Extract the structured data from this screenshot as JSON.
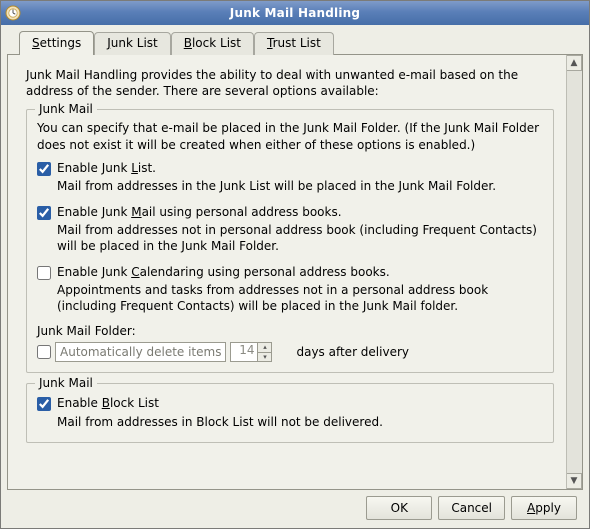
{
  "window": {
    "title": "Junk Mail Handling"
  },
  "tabs": [
    {
      "label": "Settings",
      "mnemonic": "S",
      "active": true
    },
    {
      "label": "Junk List",
      "mnemonic": "J",
      "active": false
    },
    {
      "label": "Block List",
      "mnemonic": "B",
      "active": false
    },
    {
      "label": "Trust List",
      "mnemonic": "T",
      "active": false
    }
  ],
  "intro": "Junk Mail Handling provides the ability to deal with unwanted e-mail based on the address of the sender. There are several options available:",
  "group_junk": {
    "legend": "Junk Mail",
    "desc": "You can specify that e-mail be placed in the Junk Mail Folder. (If the Junk Mail Folder does not exist it will be created when either of these options is enabled.)",
    "opt1": {
      "checked": true,
      "label_pre": "Enable Junk ",
      "mnemonic": "L",
      "label_post": "ist.",
      "desc": "Mail from addresses in the Junk List will be placed in the Junk Mail Folder."
    },
    "opt2": {
      "checked": true,
      "label_pre": "Enable Junk ",
      "mnemonic": "M",
      "label_post": "ail using personal address books.",
      "desc": "Mail from addresses not in personal address book (including Frequent Contacts) will be placed in the Junk Mail Folder."
    },
    "opt3": {
      "checked": false,
      "label_pre": "Enable Junk ",
      "mnemonic": "C",
      "label_post": "alendaring using personal address books.",
      "desc": "Appointments and tasks from addresses not in a personal address book (including Frequent Contacts) will be placed in the Junk Mail folder."
    },
    "folder_label": "Junk Mail Folder:",
    "autodel": {
      "checked": false,
      "label": "Automatically delete items",
      "value": "14",
      "suffix": "days after delivery"
    }
  },
  "group_block": {
    "legend": "Junk Mail",
    "opt": {
      "checked": true,
      "label_pre": "Enable ",
      "mnemonic": "B",
      "label_post": "lock List",
      "desc": "Mail from addresses in Block List will not be delivered."
    }
  },
  "buttons": {
    "ok": "OK",
    "cancel": "Cancel",
    "apply": "Apply"
  }
}
